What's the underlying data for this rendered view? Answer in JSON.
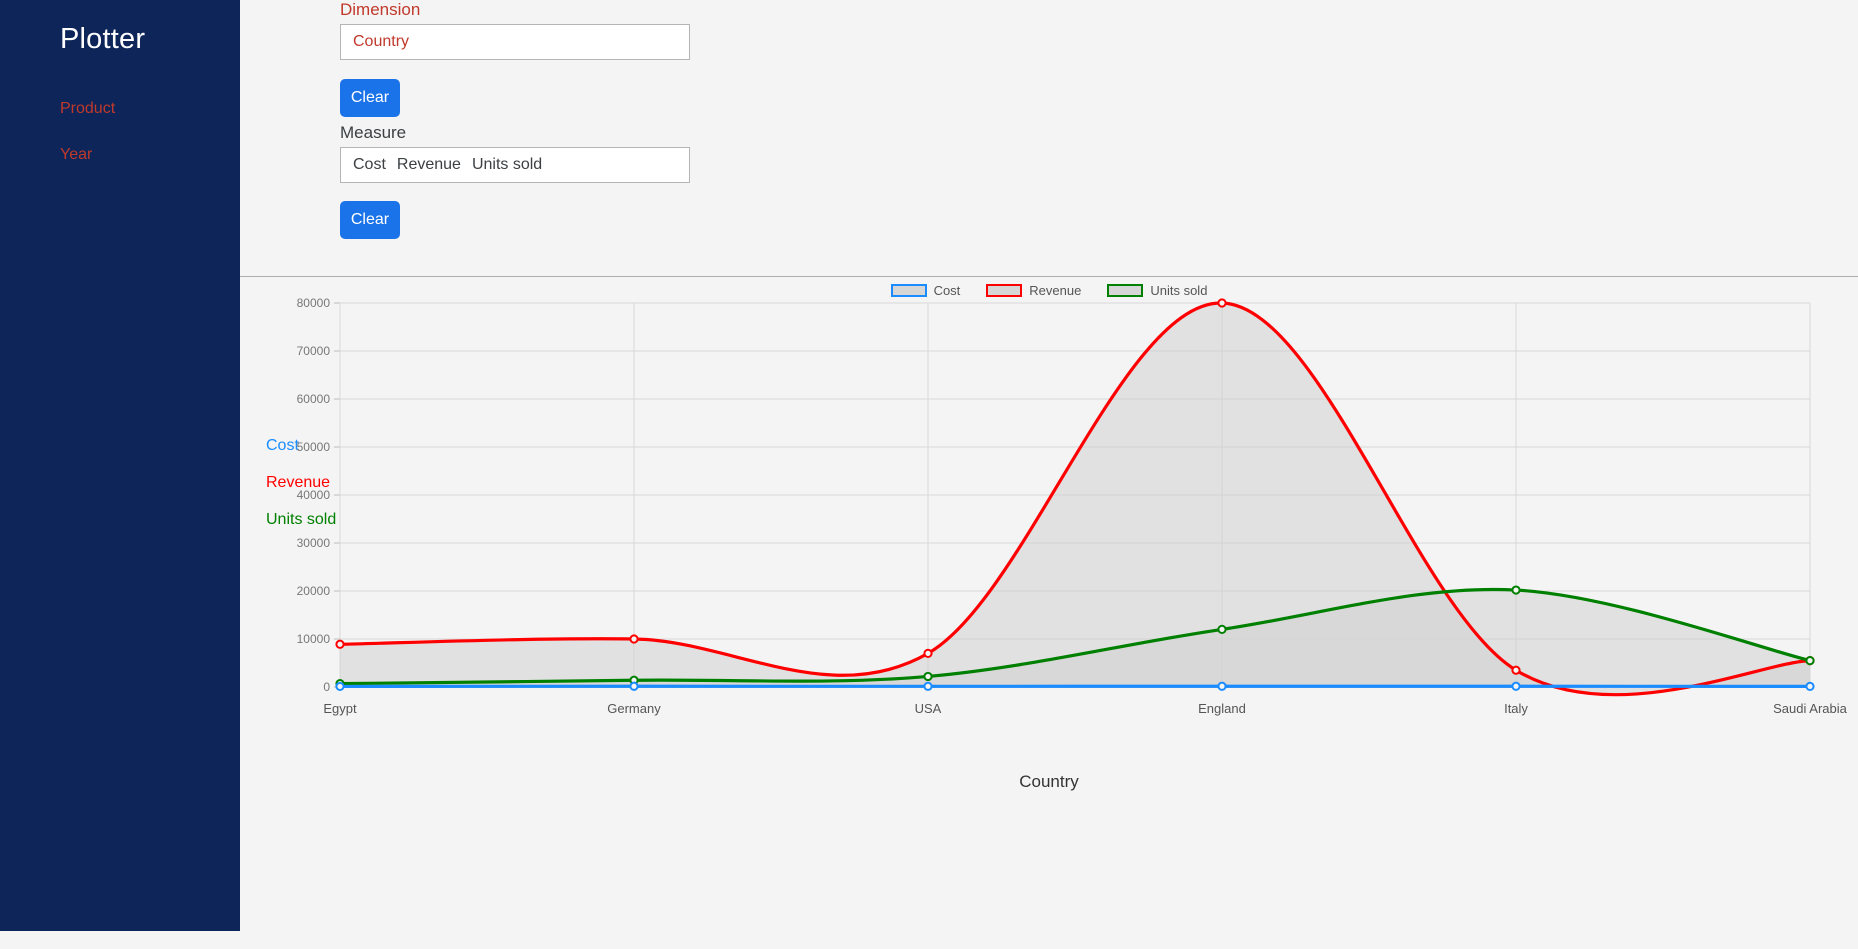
{
  "sidebar": {
    "brand": "Plotter",
    "items": [
      {
        "label": "Product"
      },
      {
        "label": "Year"
      }
    ]
  },
  "controls": {
    "dimension": {
      "label": "Dimension",
      "values": [
        "Country"
      ],
      "clear_label": "Clear"
    },
    "measure": {
      "label": "Measure",
      "values": [
        "Cost",
        "Revenue",
        "Units sold"
      ],
      "clear_label": "Clear"
    }
  },
  "measure_legend": [
    {
      "label": "Cost",
      "color": "#1a8cff"
    },
    {
      "label": "Revenue",
      "color": "#ff0000"
    },
    {
      "label": "Units sold",
      "color": "#008000"
    }
  ],
  "colors": {
    "sidebar_bg": "#0d2559",
    "accent_blue": "#1a73e8",
    "link_red": "#c0392b",
    "cost": "#1a8cff",
    "revenue": "#ff0000",
    "units_sold": "#008000",
    "area_fill": "#d2d2d2"
  },
  "chart_data": {
    "type": "area",
    "title": "",
    "xlabel": "Country",
    "ylabel": "",
    "categories": [
      "Egypt",
      "Germany",
      "USA",
      "England",
      "Italy",
      "Saudi Arabia"
    ],
    "ylim": [
      0,
      80000
    ],
    "yticks": [
      0,
      10000,
      20000,
      30000,
      40000,
      50000,
      60000,
      70000,
      80000
    ],
    "grid": true,
    "legend_position": "top-center",
    "interpolation": "smooth-spline",
    "markers": true,
    "series": [
      {
        "name": "Cost",
        "color": "#1a8cff",
        "values": [
          120,
          150,
          140,
          160,
          150,
          130
        ]
      },
      {
        "name": "Revenue",
        "color": "#ff0000",
        "values": [
          8900,
          10000,
          7000,
          80000,
          3500,
          5500
        ]
      },
      {
        "name": "Units sold",
        "color": "#008000",
        "values": [
          700,
          1400,
          2200,
          12000,
          20200,
          5500
        ]
      }
    ]
  }
}
